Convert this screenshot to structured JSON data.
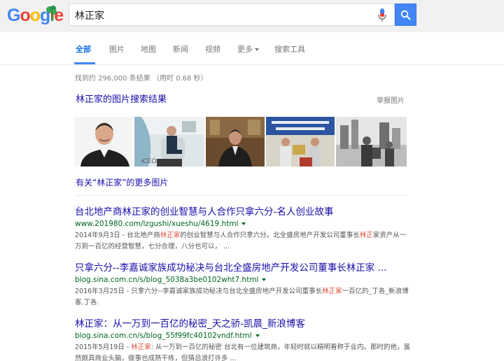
{
  "logo": {
    "text": "Google"
  },
  "search": {
    "query": "林正家"
  },
  "tabs": [
    {
      "label": "全部",
      "active": true
    },
    {
      "label": "图片"
    },
    {
      "label": "地图"
    },
    {
      "label": "新闻"
    },
    {
      "label": "视频"
    },
    {
      "label": "更多"
    },
    {
      "label": "搜索工具"
    }
  ],
  "stats": "找到约 296,000 条结果 （用时 0.68 秒）",
  "images": {
    "heading": "林正家的图片搜索结果",
    "report": "举报图片",
    "thumb_caption": "iCEO",
    "more": "有关“林正家”的更多图片"
  },
  "results": [
    {
      "title": "台北地产商林正家的创业智慧与人合作只拿六分-名人创业故事",
      "url": "www.201980.com/lzgushi/xueshu/4619.html",
      "snippet": [
        {
          "t": "2014年9月3日 - 台北地产商"
        },
        {
          "t": "林正家",
          "hl": true
        },
        {
          "t": "的创业智慧与人合作只拿六分。北全盛房地产开发公司董事长"
        },
        {
          "t": "林正",
          "hl": true
        },
        {
          "t": "家资产从一万到一百亿的经营智慧，七分合理，八分也可以， ..."
        }
      ]
    },
    {
      "title": "只拿六分--李嘉诚家族成功秘决与台北全盛房地产开发公司董事长林正家 ...",
      "url": "blog.sina.com.cn/s/blog_5038a3be0102wht7.html",
      "snippet": [
        {
          "t": "2016年3月25日 - 只拿六分--李嘉诚家族成功秘决与台北全盛房地产开发公司董事长"
        },
        {
          "t": "林正家",
          "hl": true
        },
        {
          "t": "一百亿的_丁各_新浪博客,丁各."
        }
      ]
    },
    {
      "title": "林正家：从一万到一百亿的秘密_天之骄-凯晨_新浪博客",
      "url": "blog.sina.com.cn/s/blog_55f99fc40102vndf.html",
      "snippet": [
        {
          "t": "2015年5月19日 - "
        },
        {
          "t": "林正家",
          "hl": true
        },
        {
          "t": ": 从一万到一百亿的秘密 台北有一位建筑商，年轻时就以精明看称于业内。那时的他，虽然颇具商业头脑，做事也成熟干练，但猜忌浪打许多 ..."
        }
      ]
    }
  ],
  "colors": {
    "accent": "#4285f4",
    "link": "#1a0dab",
    "url": "#006621",
    "highlight": "#dd4b39"
  }
}
